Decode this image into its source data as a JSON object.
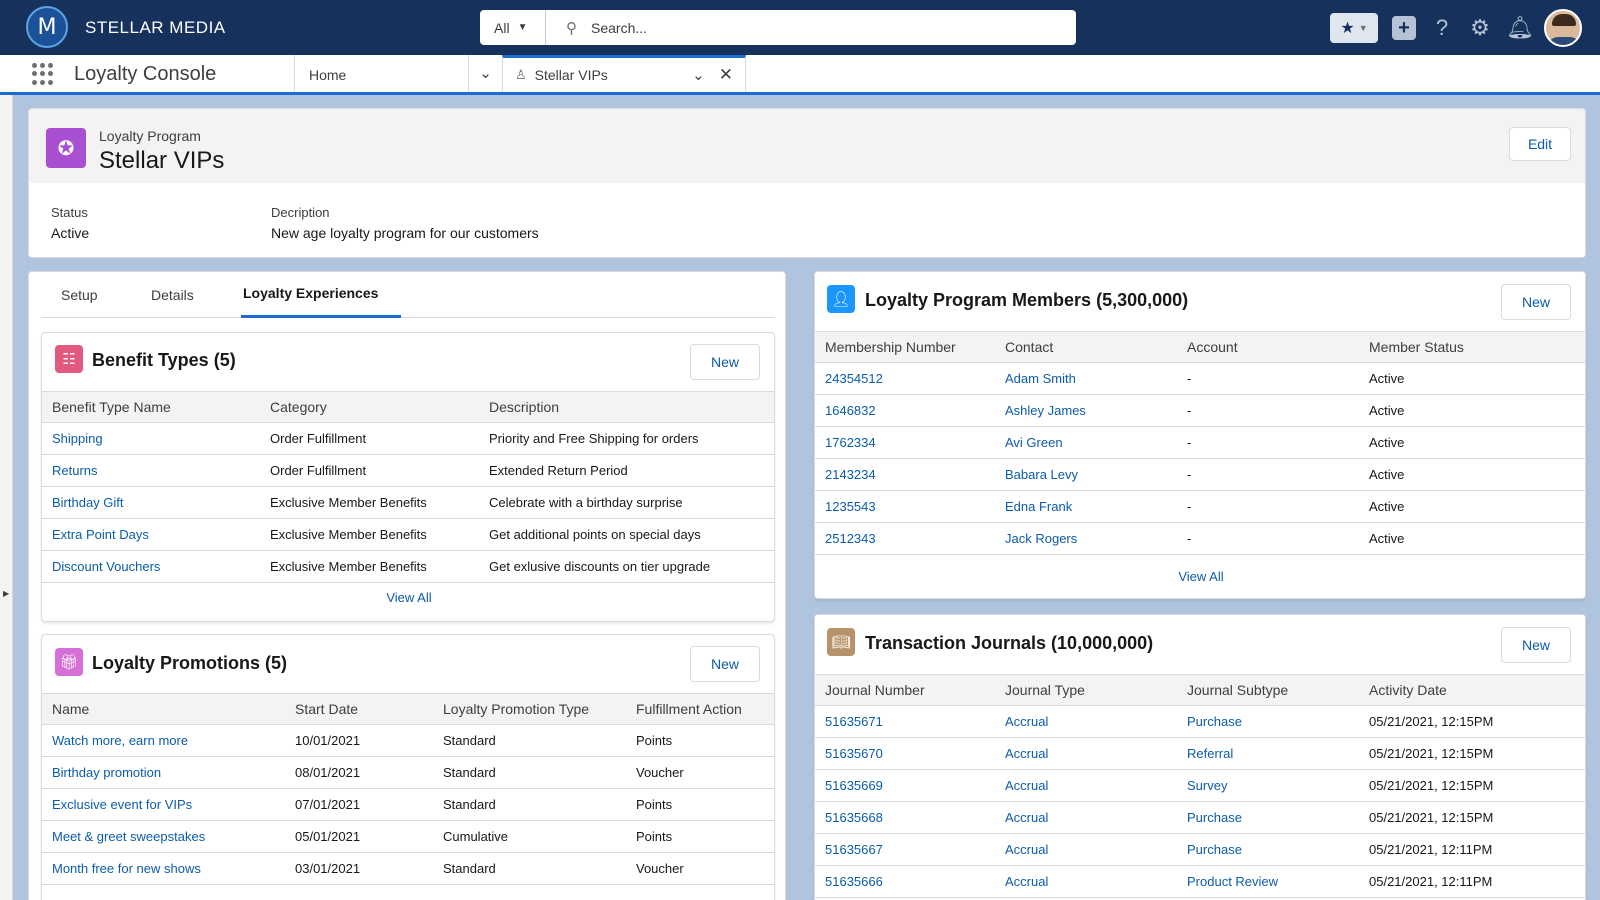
{
  "header": {
    "brand": "STELLAR MEDIA",
    "logo_letter": "M",
    "search_scope": "All",
    "search_placeholder": "Search..."
  },
  "nav": {
    "app_name": "Loyalty Console",
    "tabs": [
      {
        "label": "Home"
      },
      {
        "label": "Stellar VIPs"
      }
    ]
  },
  "record": {
    "type_label": "Loyalty Program",
    "title": "Stellar VIPs",
    "edit_label": "Edit",
    "fields": {
      "status_label": "Status",
      "status_value": "Active",
      "description_label": "Decription",
      "description_value": "New age loyalty program for our customers"
    }
  },
  "left_tabs": [
    "Setup",
    "Details",
    "Loyalty Experiences"
  ],
  "benefit_types": {
    "title": "Benefit Types (5)",
    "new_label": "New",
    "view_all": "View All",
    "columns": [
      "Benefit Type Name",
      "Category",
      "Description"
    ],
    "rows": [
      [
        "Shipping",
        "Order Fulfillment",
        "Priority and Free Shipping for orders"
      ],
      [
        "Returns",
        "Order Fulfillment",
        "Extended Return Period"
      ],
      [
        "Birthday Gift",
        "Exclusive Member Benefits",
        "Celebrate with a birthday surprise"
      ],
      [
        "Extra Point Days",
        "Exclusive Member Benefits",
        "Get additional points on special days"
      ],
      [
        "Discount Vouchers",
        "Exclusive Member Benefits",
        "Get exlusive discounts on tier upgrade"
      ]
    ]
  },
  "promotions": {
    "title": "Loyalty Promotions (5)",
    "new_label": "New",
    "columns": [
      "Name",
      "Start Date",
      "Loyalty Promotion Type",
      "Fulfillment Action"
    ],
    "rows": [
      [
        "Watch more, earn more",
        "10/01/2021",
        "Standard",
        "Points"
      ],
      [
        "Birthday promotion",
        "08/01/2021",
        "Standard",
        "Voucher"
      ],
      [
        "Exclusive event for VIPs",
        "07/01/2021",
        "Standard",
        "Points"
      ],
      [
        "Meet & greet sweepstakes",
        "05/01/2021",
        "Cumulative",
        "Points"
      ],
      [
        "Month free for new shows",
        "03/01/2021",
        "Standard",
        "Voucher"
      ]
    ]
  },
  "members": {
    "title": "Loyalty Program Members (5,300,000)",
    "new_label": "New",
    "view_all": "View All",
    "columns": [
      "Membership Number",
      "Contact",
      "Account",
      "Member Status"
    ],
    "rows": [
      [
        "24354512",
        "Adam Smith",
        "-",
        "Active"
      ],
      [
        "1646832",
        "Ashley James",
        "-",
        "Active"
      ],
      [
        "1762334",
        "Avi Green",
        "-",
        "Active"
      ],
      [
        "2143234",
        "Babara Levy",
        "-",
        "Active"
      ],
      [
        "1235543",
        "Edna Frank",
        "-",
        "Active"
      ],
      [
        "2512343",
        "Jack Rogers",
        "-",
        "Active"
      ]
    ]
  },
  "journals": {
    "title": "Transaction Journals (10,000,000)",
    "new_label": "New",
    "columns": [
      "Journal Number",
      "Journal Type",
      "Journal Subtype",
      "Activity Date"
    ],
    "rows": [
      [
        "51635671",
        "Accrual",
        "Purchase",
        "05/21/2021, 12:15PM"
      ],
      [
        "51635670",
        "Accrual",
        "Referral",
        "05/21/2021, 12:15PM"
      ],
      [
        "51635669",
        "Accrual",
        "Survey",
        "05/21/2021, 12:15PM"
      ],
      [
        "51635668",
        "Accrual",
        "Purchase",
        "05/21/2021, 12:15PM"
      ],
      [
        "51635667",
        "Accrual",
        "Purchase",
        "05/21/2021, 12:11PM"
      ],
      [
        "51635666",
        "Accrual",
        "Product Review",
        "05/21/2021, 12:11PM"
      ]
    ]
  },
  "colors": {
    "header_bg": "#16325c",
    "accent": "#1b6cd1",
    "link": "#0b5cab",
    "program_icon": "#a94fd2",
    "benefit_icon": "#e3587f",
    "promo_icon": "#d66fd6",
    "member_icon": "#1b96ff",
    "journal_icon": "#b8926a"
  },
  "icons": {
    "search": "search-icon",
    "favorite": "star-icon",
    "add": "plus-icon",
    "help": "question-icon",
    "setup": "gear-icon",
    "notifications": "bell-icon"
  }
}
